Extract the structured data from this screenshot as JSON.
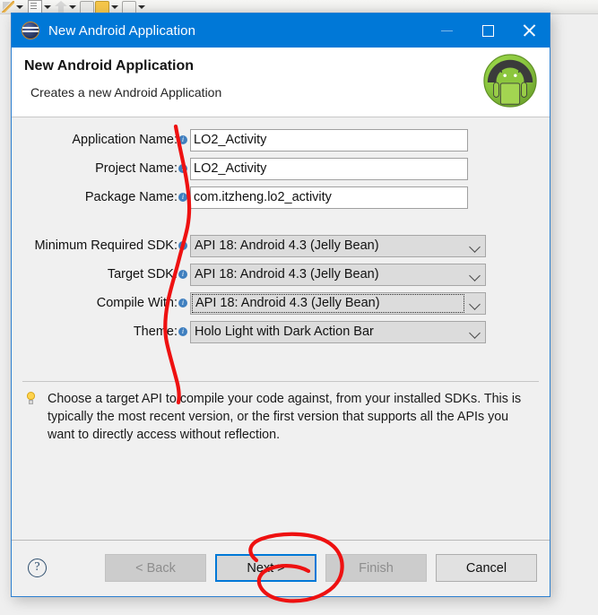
{
  "background": {
    "toolbar_icons": [
      "pencil-icon",
      "dropdown-caret",
      "note-icon",
      "dropdown-caret",
      "up-arrow-icon",
      "dropdown-caret",
      "balloon-grey-icon",
      "balloon-yellow-icon",
      "dropdown-caret",
      "balloon-outline-icon",
      "dropdown-caret"
    ]
  },
  "window": {
    "title": "New Android Application",
    "icon": "eclipse-icon",
    "controls": {
      "minimize": "minimize-icon",
      "maximize": "maximize-icon",
      "close": "close-icon"
    }
  },
  "header": {
    "title": "New Android Application",
    "subtitle": "Creates a new Android Application",
    "logo": "android-robot-icon"
  },
  "form": {
    "text_fields": [
      {
        "label": "Application Name:",
        "value": "LO2_Activity",
        "info": "info-icon"
      },
      {
        "label": "Project Name:",
        "value": "LO2_Activity",
        "info": "info-icon"
      },
      {
        "label": "Package Name:",
        "value": "com.itzheng.lo2_activity",
        "info": "info-icon"
      }
    ],
    "dropdowns": [
      {
        "label": "Minimum Required SDK:",
        "value": "API 18: Android 4.3 (Jelly Bean)",
        "focused": false
      },
      {
        "label": "Target SDK:",
        "value": "API 18: Android 4.3 (Jelly Bean)",
        "focused": false
      },
      {
        "label": "Compile With:",
        "value": "API 18: Android 4.3 (Jelly Bean)",
        "focused": true
      },
      {
        "label": "Theme:",
        "value": "Holo Light with Dark Action Bar",
        "focused": false
      }
    ]
  },
  "hint": {
    "icon": "lightbulb-icon",
    "text": "Choose a target API to compile your code against, from your installed SDKs. This is typically the most recent version, or the first version that supports all the APIs you want to directly access without reflection."
  },
  "footer": {
    "help": "?",
    "buttons": [
      {
        "label": "< Back",
        "state": "disabled"
      },
      {
        "label": "Next >",
        "state": "focused"
      },
      {
        "label": "Finish",
        "state": "disabled"
      },
      {
        "label": "Cancel",
        "state": "enabled"
      }
    ]
  },
  "annotations": {
    "color": "#ee1111",
    "marks": [
      "vertical-squiggle-line",
      "circle-around-next-button"
    ]
  },
  "colors": {
    "titlebar": "#0078d7",
    "dialog_border": "#2c7fd0",
    "dialog_bg": "#f0f0f0",
    "focus_blue": "#0078d7",
    "annotation_red": "#ee1111"
  }
}
